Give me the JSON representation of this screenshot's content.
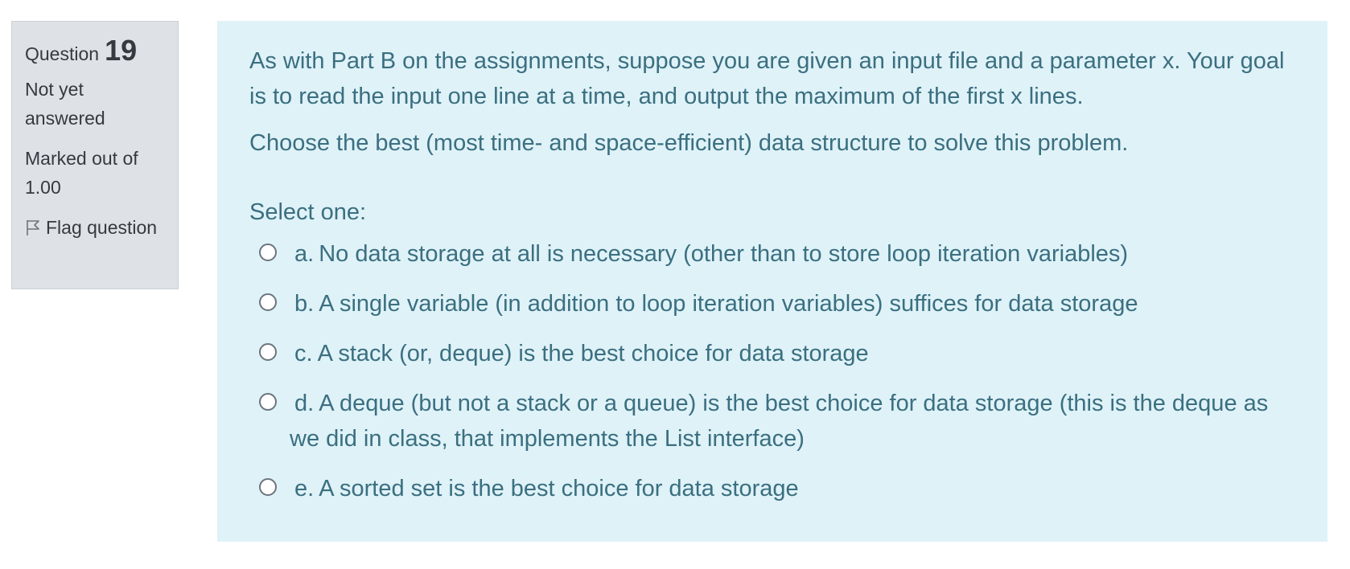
{
  "question": {
    "label": "Question",
    "number": "19",
    "state": "Not yet answered",
    "grade": "Marked out of 1.00",
    "flag_label": "Flag question",
    "flag_icon": "flag-icon"
  },
  "content": {
    "paragraphs": [
      "As with Part B on the assignments, suppose you are given an input file and a parameter x. Your goal is to read the input one line at a time, and output the maximum of the first x lines.",
      "Choose the best (most time- and space-efficient) data structure to solve this problem."
    ],
    "prompt": "Select one:",
    "answers": [
      {
        "letter": "a.",
        "text": "No data storage at all is necessary (other than to store loop iteration variables)"
      },
      {
        "letter": "b.",
        "text": "A single variable (in addition to loop iteration variables) suffices for data storage"
      },
      {
        "letter": "c.",
        "text": "A stack (or, deque) is the best choice for data storage"
      },
      {
        "letter": "d.",
        "text": "A deque (but not a stack or a queue) is the best choice for data storage (this is the deque as we did in class, that implements the List interface)"
      },
      {
        "letter": "e.",
        "text": "A sorted set is the best choice for data storage"
      }
    ]
  },
  "colors": {
    "content_bg": "#def2f8",
    "content_text": "#3b6f80",
    "info_bg": "#dee2e6"
  }
}
